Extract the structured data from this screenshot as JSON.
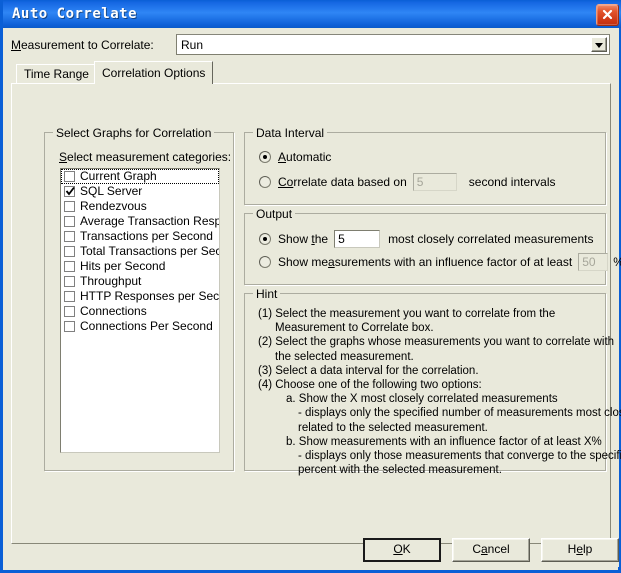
{
  "window": {
    "title": "Auto Correlate",
    "close_icon": "close-icon"
  },
  "combo": {
    "label_prefix": "M",
    "label_rest": "easurement to Correlate:",
    "value": "Run",
    "arrow_icon": "chevron-down-icon"
  },
  "tabs": [
    {
      "id": "time-range",
      "label": "Time Range",
      "active": false
    },
    {
      "id": "correlation-options",
      "label": "Correlation Options",
      "active": true
    }
  ],
  "select_graphs": {
    "group_title": "Select Graphs for Correlation",
    "list_label_prefix": "S",
    "list_label_rest": "elect measurement categories:",
    "items": [
      {
        "label": "Current Graph",
        "checked": false,
        "focused": true
      },
      {
        "label": "SQL Server",
        "checked": true,
        "focused": false
      },
      {
        "label": "Rendezvous",
        "checked": false,
        "focused": false
      },
      {
        "label": "Average Transaction Response Time",
        "checked": false,
        "focused": false
      },
      {
        "label": "Transactions per Second",
        "checked": false,
        "focused": false
      },
      {
        "label": "Total Transactions per Second",
        "checked": false,
        "focused": false
      },
      {
        "label": "Hits per Second",
        "checked": false,
        "focused": false
      },
      {
        "label": "Throughput",
        "checked": false,
        "focused": false
      },
      {
        "label": "HTTP Responses per Second",
        "checked": false,
        "focused": false
      },
      {
        "label": "Connections",
        "checked": false,
        "focused": false
      },
      {
        "label": "Connections Per Second",
        "checked": false,
        "focused": false
      }
    ]
  },
  "data_interval": {
    "group_title": "Data Interval",
    "option_automatic": {
      "prefix": "A",
      "rest": "utomatic",
      "selected": true
    },
    "option_correlate": {
      "prefix": "Co",
      "rest": "rrelate data based on",
      "selected": false,
      "value": "5",
      "suffix": "second intervals",
      "disabled": true
    }
  },
  "output": {
    "group_title": "Output",
    "option_show_the": {
      "lead": "Show ",
      "accel": "t",
      "lead_rest": "he",
      "selected": true,
      "value": "5",
      "suffix": "most closely correlated measurements"
    },
    "option_influence": {
      "lead": "Show me",
      "accel": "a",
      "lead_rest": "surements with an influence factor of at least",
      "selected": false,
      "value": "50",
      "suffix": "%",
      "disabled": true
    }
  },
  "hint": {
    "group_title": "Hint",
    "lines": [
      {
        "indent": 1,
        "text": "(1) Select the measurement you want to correlate from the"
      },
      {
        "indent": 2,
        "text": "Measurement to Correlate box."
      },
      {
        "indent": 1,
        "text": "(2) Select the graphs whose measurements you want to correlate with"
      },
      {
        "indent": 2,
        "text": "the selected measurement."
      },
      {
        "indent": 1,
        "text": "(3) Select a data interval for the correlation."
      },
      {
        "indent": 1,
        "text": "(4) Choose one of the following two options:"
      },
      {
        "indent": 3,
        "text": "a. Show the X most closely correlated measurements"
      },
      {
        "indent": 4,
        "text": "- displays only the specified number of measurements most closely"
      },
      {
        "indent": 4,
        "text": "related to the selected measurement."
      },
      {
        "indent": 3,
        "text": "b. Show measurements with an influence factor of at least X%"
      },
      {
        "indent": 4,
        "text": "- displays only those measurements that converge to the specified"
      },
      {
        "indent": 4,
        "text": "percent with the selected measurement."
      }
    ]
  },
  "buttons": {
    "ok": {
      "prefix": "O",
      "accel": "K",
      "default": true
    },
    "cancel": {
      "prefix": "C",
      "accel": "a",
      "rest": "ncel"
    },
    "help": {
      "prefix": "H",
      "accel": "e",
      "rest": "lp"
    }
  },
  "colors": {
    "titlebar_blue": "#1668E3",
    "dialog_face": "#E9E9DB",
    "close_red": "#D13B18",
    "field_white": "#FFFFFF",
    "border_gray": "#ACACA0"
  }
}
